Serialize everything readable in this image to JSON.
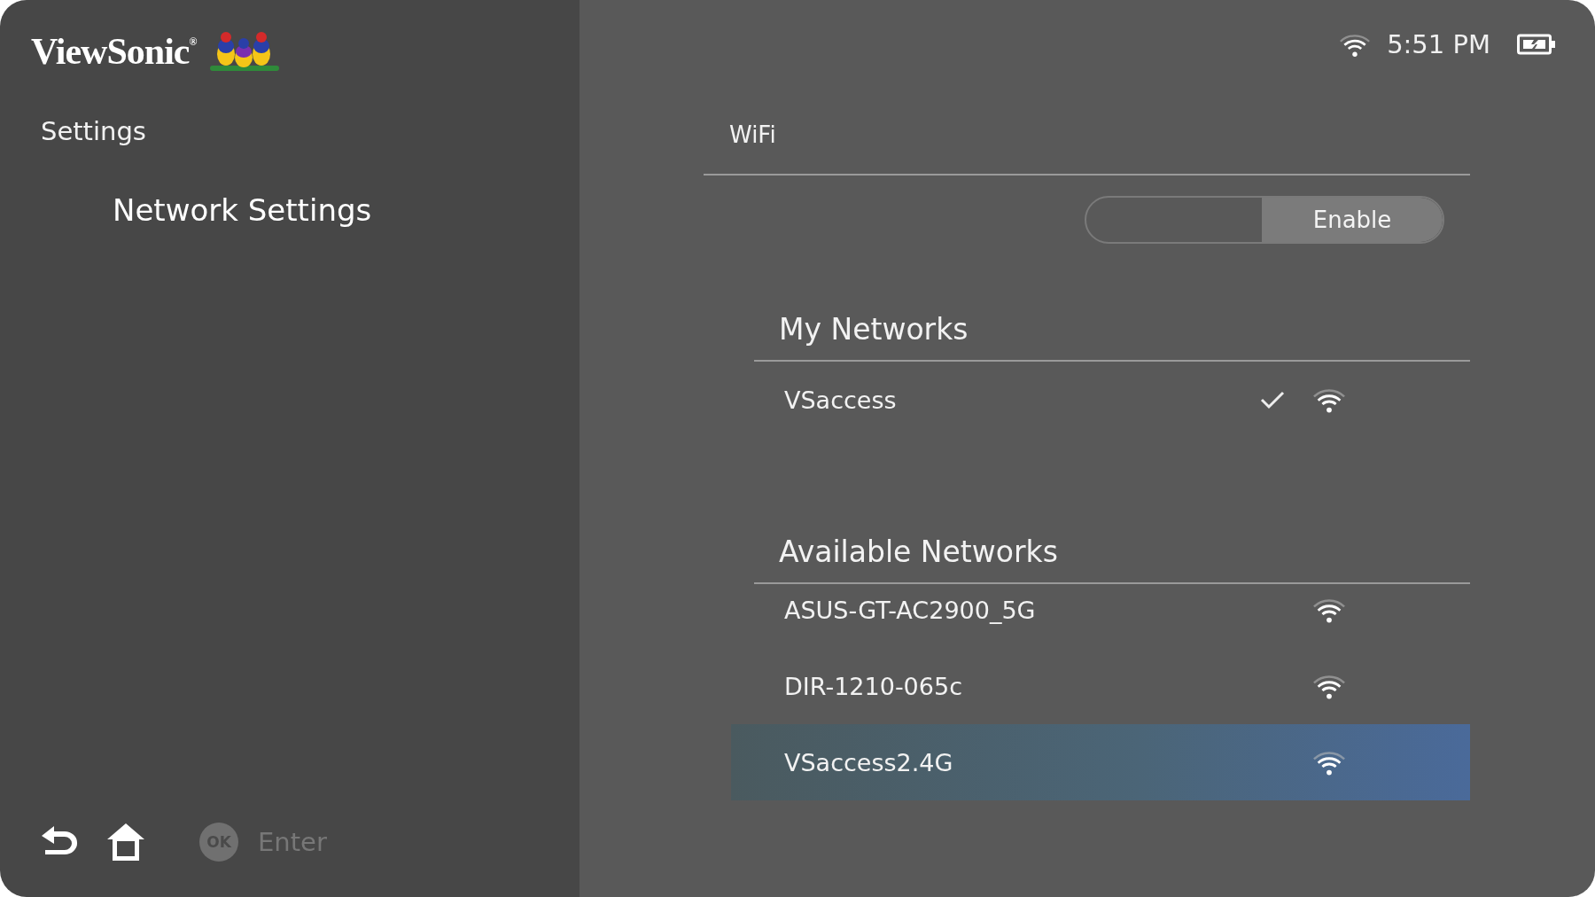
{
  "sidebar": {
    "logo": "ViewSonic$^{®}$",
    "title": "Settings",
    "items": [
      {
        "label": "Network Settings",
        "selected": true
      }
    ]
  },
  "footer": {
    "ok_key": "OK",
    "ok_label": "Enter"
  },
  "status_bar": {
    "time": "5:51 PM"
  },
  "wifi": {
    "title": "WiFi",
    "toggle": {
      "label": "Enable",
      "on": true
    },
    "sections": [
      {
        "title": "My Networks",
        "networks": [
          {
            "name": "VSaccess",
            "connected": true,
            "selected": false
          }
        ]
      },
      {
        "title": "Available Networks",
        "networks": [
          {
            "name": "ASUS-GT-AC2900_5G",
            "connected": false,
            "selected": false
          },
          {
            "name": "DIR-1210-065c",
            "connected": false,
            "selected": false
          },
          {
            "name": "VSaccess2.4G",
            "connected": false,
            "selected": true
          }
        ]
      }
    ]
  }
}
